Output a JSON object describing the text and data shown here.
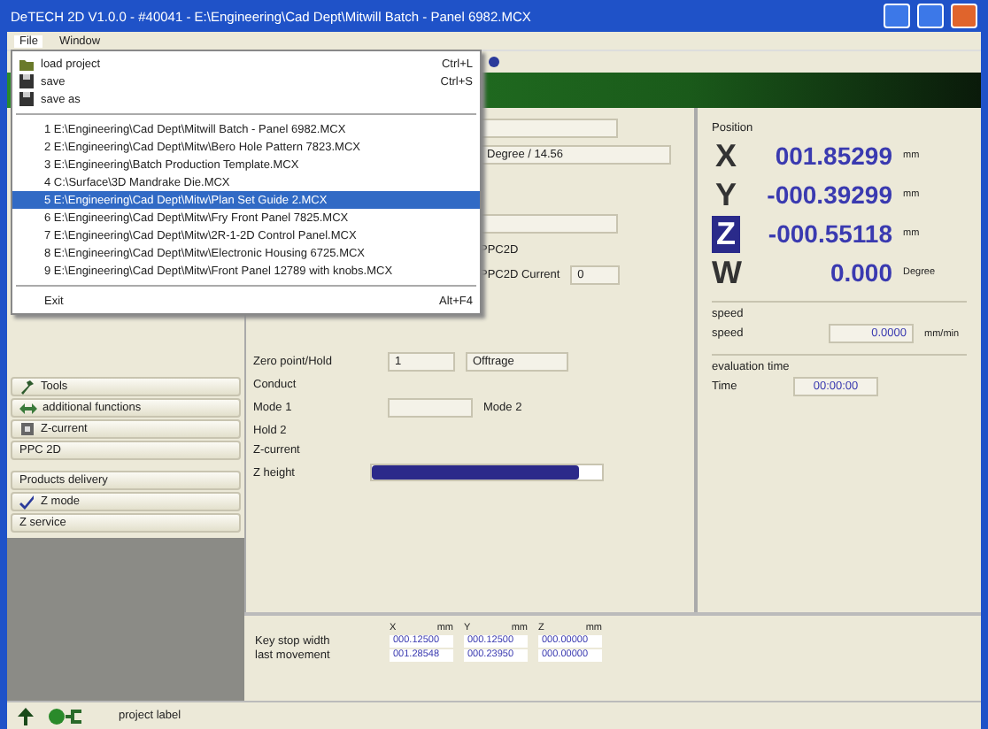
{
  "window": {
    "title": "DeTECH 2D V1.0.0 - #40041 - E:\\Engineering\\Cad Dept\\Mitwill Batch - Panel 6982.MCX"
  },
  "menubar": [
    {
      "label": "File",
      "selected": true
    },
    {
      "label": "Window",
      "selected": false
    }
  ],
  "file_menu": {
    "commands": [
      {
        "label": "load project",
        "shortcut": "Ctrl+L"
      },
      {
        "label": "save",
        "shortcut": "Ctrl+S"
      },
      {
        "label": "save as"
      }
    ],
    "recent_files": [
      {
        "label": "1 E:\\Engineering\\Cad Dept\\Mitwill Batch - Panel 6982.MCX",
        "selected": false
      },
      {
        "label": "2 E:\\Engineering\\Cad Dept\\Mitw\\Bero Hole Pattern 7823.MCX",
        "selected": false
      },
      {
        "label": "3 E:\\Engineering\\Batch Production Template.MCX",
        "selected": false
      },
      {
        "label": "4 C:\\Surface\\3D Mandrake Die.MCX",
        "selected": false
      },
      {
        "label": "5 E:\\Engineering\\Cad Dept\\Mitw\\Plan Set Guide 2.MCX",
        "selected": true
      },
      {
        "label": "6 E:\\Engineering\\Cad Dept\\Mitw\\Fry Front Panel 7825.MCX",
        "selected": false
      },
      {
        "label": "7 E:\\Engineering\\Cad Dept\\Mitw\\2R-1-2D Control Panel.MCX",
        "selected": false
      },
      {
        "label": "8 E:\\Engineering\\Cad Dept\\Mitw\\Electronic Housing 6725.MCX",
        "selected": false
      },
      {
        "label": "9 E:\\Engineering\\Cad Dept\\Mitw\\Front Panel 12789 with knobs.MCX",
        "selected": false
      }
    ],
    "exit": {
      "label": "Exit",
      "shortcut": "Alt+F4"
    }
  },
  "sidebar": {
    "items": [
      {
        "label": "Tools",
        "kind": "tools"
      },
      {
        "label": "additional functions",
        "kind": "functions"
      },
      {
        "label": "Z-current",
        "kind": "current"
      },
      {
        "label": "PPC 2D",
        "kind": "plain"
      },
      {
        "label": "Products delivery",
        "kind": "plain"
      },
      {
        "label": "Z mode",
        "kind": "mode"
      },
      {
        "label": "Z service",
        "kind": "plain"
      }
    ]
  },
  "settings": {
    "angle": "Degree / 14.56",
    "ppc": "PPC2D",
    "ppc_current_label": "PPC2D Current",
    "ppc_current": "0",
    "zero_label": "Zero point/Hold",
    "zero_value": "1",
    "zero_mode": "Offtrage",
    "conduct": "Conduct",
    "mode_1": "Mode 1",
    "mode_2": "Mode 2",
    "hold_2": "Hold 2",
    "z_current": "Z-current",
    "z_height": {
      "label": "Z height",
      "level": 0.9
    }
  },
  "position": {
    "title": "Position",
    "axes": [
      {
        "axis": "X",
        "value": "001.85299",
        "unit": "mm",
        "selected": false
      },
      {
        "axis": "Y",
        "value": "-000.39299",
        "unit": "mm",
        "selected": false
      },
      {
        "axis": "Z",
        "value": "-000.55118",
        "unit": "mm",
        "selected": true
      },
      {
        "axis": "W",
        "value": "0.000",
        "unit": "Degree",
        "selected": false
      }
    ],
    "speed_title": "speed",
    "speed_label": "speed",
    "speed_value": "0.0000",
    "speed_unit": "mm/min",
    "time_title": "evaluation time",
    "time_label": "Time",
    "time_value": "00:00:00"
  },
  "offsets": {
    "columns": [
      "X",
      "mm",
      "Y",
      "mm",
      "Z",
      "mm"
    ],
    "rows": [
      {
        "label": "Key stop width",
        "values": [
          "000.12500",
          "000.12500",
          "000.00000"
        ]
      },
      {
        "label": "last movement",
        "values": [
          "001.28548",
          "000.23950",
          "000.00000"
        ]
      }
    ]
  },
  "status_bar": {
    "label": "project label"
  }
}
